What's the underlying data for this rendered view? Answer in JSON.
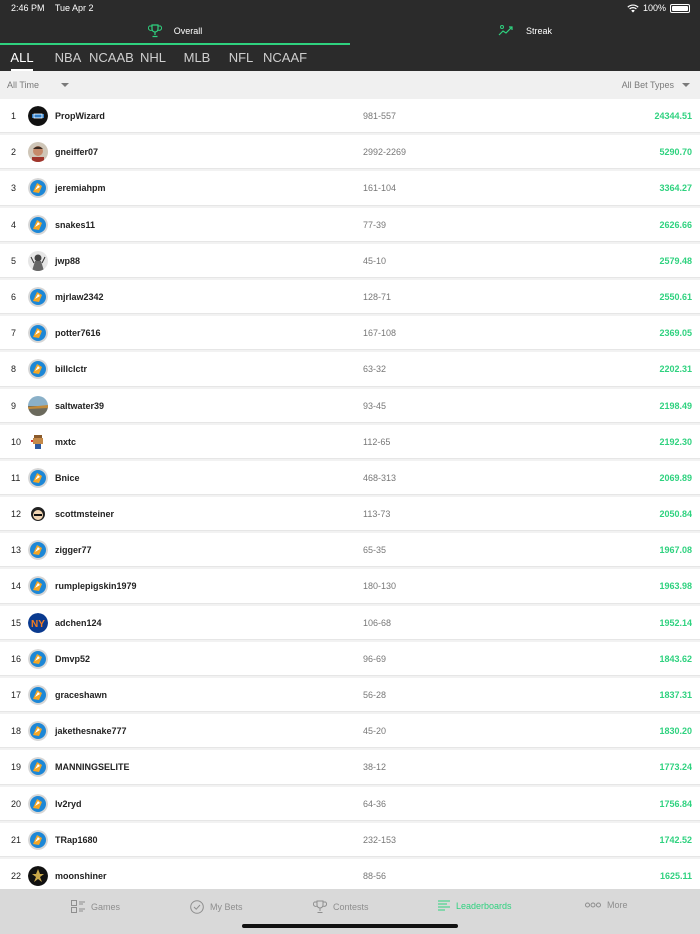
{
  "status": {
    "time": "2:46 PM",
    "date": "Tue Apr 2",
    "battery": "100%"
  },
  "segments": [
    {
      "label": "Overall",
      "icon": "trophy-icon",
      "active": true
    },
    {
      "label": "Streak",
      "icon": "streak-icon",
      "active": false
    }
  ],
  "leagues": [
    "ALL",
    "NBA",
    "NCAAB",
    "NHL",
    "MLB",
    "NFL",
    "NCAAF"
  ],
  "filters": {
    "time": "All Time",
    "bet_types": "All Bet Types"
  },
  "rows": [
    {
      "rank": "1",
      "name": "PropWizard",
      "record": "981-557",
      "score": "24344.51",
      "avatar": "logo-dark"
    },
    {
      "rank": "2",
      "name": "gneiffer07",
      "record": "2992-2269",
      "score": "5290.70",
      "avatar": "photo"
    },
    {
      "rank": "3",
      "name": "jeremiahpm",
      "record": "161-104",
      "score": "3364.27",
      "avatar": "default"
    },
    {
      "rank": "4",
      "name": "snakes11",
      "record": "77-39",
      "score": "2626.66",
      "avatar": "default"
    },
    {
      "rank": "5",
      "name": "jwp88",
      "record": "45-10",
      "score": "2579.48",
      "avatar": "photo-bw"
    },
    {
      "rank": "6",
      "name": "mjrlaw2342",
      "record": "128-71",
      "score": "2550.61",
      "avatar": "default"
    },
    {
      "rank": "7",
      "name": "potter7616",
      "record": "167-108",
      "score": "2369.05",
      "avatar": "default"
    },
    {
      "rank": "8",
      "name": "billclctr",
      "record": "63-32",
      "score": "2202.31",
      "avatar": "default"
    },
    {
      "rank": "9",
      "name": "saltwater39",
      "record": "93-45",
      "score": "2198.49",
      "avatar": "landscape"
    },
    {
      "rank": "10",
      "name": "mxtc",
      "record": "112-65",
      "score": "2192.30",
      "avatar": "pixel"
    },
    {
      "rank": "11",
      "name": "Bnice",
      "record": "468-313",
      "score": "2069.89",
      "avatar": "default"
    },
    {
      "rank": "12",
      "name": "scottmsteiner",
      "record": "113-73",
      "score": "2050.84",
      "avatar": "cartoon"
    },
    {
      "rank": "13",
      "name": "zigger77",
      "record": "65-35",
      "score": "1967.08",
      "avatar": "default"
    },
    {
      "rank": "14",
      "name": "rumplepigskin1979",
      "record": "180-130",
      "score": "1963.98",
      "avatar": "default"
    },
    {
      "rank": "15",
      "name": "adchen124",
      "record": "106-68",
      "score": "1952.14",
      "avatar": "mets"
    },
    {
      "rank": "16",
      "name": "Dmvp52",
      "record": "96-69",
      "score": "1843.62",
      "avatar": "default"
    },
    {
      "rank": "17",
      "name": "graceshawn",
      "record": "56-28",
      "score": "1837.31",
      "avatar": "default"
    },
    {
      "rank": "18",
      "name": "jakethesnake777",
      "record": "45-20",
      "score": "1830.20",
      "avatar": "default"
    },
    {
      "rank": "19",
      "name": "MANNINGSELITE",
      "record": "38-12",
      "score": "1773.24",
      "avatar": "default"
    },
    {
      "rank": "20",
      "name": "lv2ryd",
      "record": "64-36",
      "score": "1756.84",
      "avatar": "default"
    },
    {
      "rank": "21",
      "name": "TRap1680",
      "record": "232-153",
      "score": "1742.52",
      "avatar": "default"
    },
    {
      "rank": "22",
      "name": "moonshiner",
      "record": "88-56",
      "score": "1625.11",
      "avatar": "saints"
    }
  ],
  "tabs": [
    {
      "label": "Games",
      "icon": "games-icon",
      "active": false
    },
    {
      "label": "My Bets",
      "icon": "check-circle-icon",
      "active": false
    },
    {
      "label": "Contests",
      "icon": "trophy-icon",
      "active": false
    },
    {
      "label": "Leaderboards",
      "icon": "list-icon",
      "active": true
    },
    {
      "label": "More",
      "icon": "more-dots-icon",
      "active": false
    }
  ],
  "colors": {
    "accent": "#2fd27f",
    "header_bg": "#2b2b2b",
    "tabbar_bg": "#d9d9d9"
  }
}
